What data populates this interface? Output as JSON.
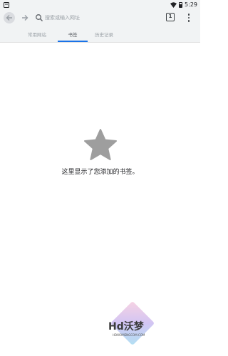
{
  "status_bar": {
    "time": "5:29",
    "left_icon": "notification-icon",
    "right_icons": [
      "wifi-icon",
      "battery-icon"
    ]
  },
  "toolbar": {
    "back_icon": "arrow-left-icon",
    "forward_icon": "arrow-right-icon",
    "search_icon": "search-icon",
    "search_placeholder": "搜索或输入网址",
    "tab_count": "1",
    "menu_icon": "more-vert-icon"
  },
  "tabs": [
    {
      "label": "常用网站",
      "active": false
    },
    {
      "label": "书签",
      "active": true
    },
    {
      "label": "历史记录",
      "active": false
    }
  ],
  "empty_state": {
    "icon": "star-icon",
    "message": "这里显示了您添加的书签。"
  },
  "watermark": {
    "text": "Hd沃梦",
    "subtext": "HDWOMENGCOM.COM"
  },
  "colors": {
    "toolbar_bg": "#f1f3f4",
    "accent": "#1a73e8",
    "star": "#9e9e9e",
    "text": "#202124"
  }
}
